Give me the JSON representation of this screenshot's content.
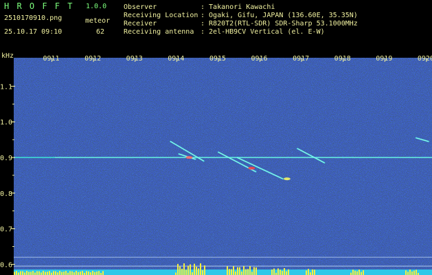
{
  "header": {
    "app_title": "H R O F F T",
    "version": "1.0.0",
    "filename": "2510170910.png",
    "datetime": "25.10.17 09:10",
    "meteor_label": "meteor",
    "meteor_count": "62",
    "info": [
      {
        "label": "Observer",
        "value": ": Takanori Kawachi"
      },
      {
        "label": "Receiving Location",
        "value": ": Ogaki, Gifu, JAPAN (136.60E, 35.35N)"
      },
      {
        "label": "Receiver",
        "value": ": R820T2(RTL-SDR) SDR-Sharp 53.1000MHz"
      },
      {
        "label": "Receiving antenna",
        "value": ": 2el-HB9CV Vertical (el. E-W)"
      }
    ]
  },
  "chart_data": {
    "type": "heatmap",
    "title": "",
    "ylabel": "kHz",
    "x_ticks": [
      "0911",
      "0912",
      "0913",
      "0914",
      "0915",
      "0916",
      "0917",
      "0918",
      "0919",
      "0920"
    ],
    "y_ticks": [
      "1.1",
      "1.0",
      "0.9",
      "0.8",
      "0.7",
      "0.6"
    ],
    "ylim": [
      0.57,
      1.18
    ],
    "carrier_khz": 0.9,
    "meteor_traces": [
      {
        "t_start": 13.85,
        "f_start": 0.945,
        "t_end": 14.65,
        "f_end": 0.89
      },
      {
        "t_start": 14.05,
        "f_start": 0.91,
        "t_end": 14.45,
        "f_end": 0.895
      },
      {
        "t_start": 15.0,
        "f_start": 0.915,
        "t_end": 15.9,
        "f_end": 0.86
      },
      {
        "t_start": 15.45,
        "f_start": 0.9,
        "t_end": 16.55,
        "f_end": 0.84
      },
      {
        "t_start": 16.9,
        "f_start": 0.925,
        "t_end": 17.55,
        "f_end": 0.885
      },
      {
        "t_start": 19.75,
        "f_start": 0.955,
        "t_end": 20.05,
        "f_end": 0.945
      }
    ],
    "bright_spots": [
      {
        "t": 14.3,
        "f": 0.9,
        "color": "#ff6060"
      },
      {
        "t": 15.8,
        "f": 0.87,
        "color": "#ff4040"
      },
      {
        "t": 16.65,
        "f": 0.84,
        "color": "#ffff60"
      }
    ],
    "grid": true
  }
}
